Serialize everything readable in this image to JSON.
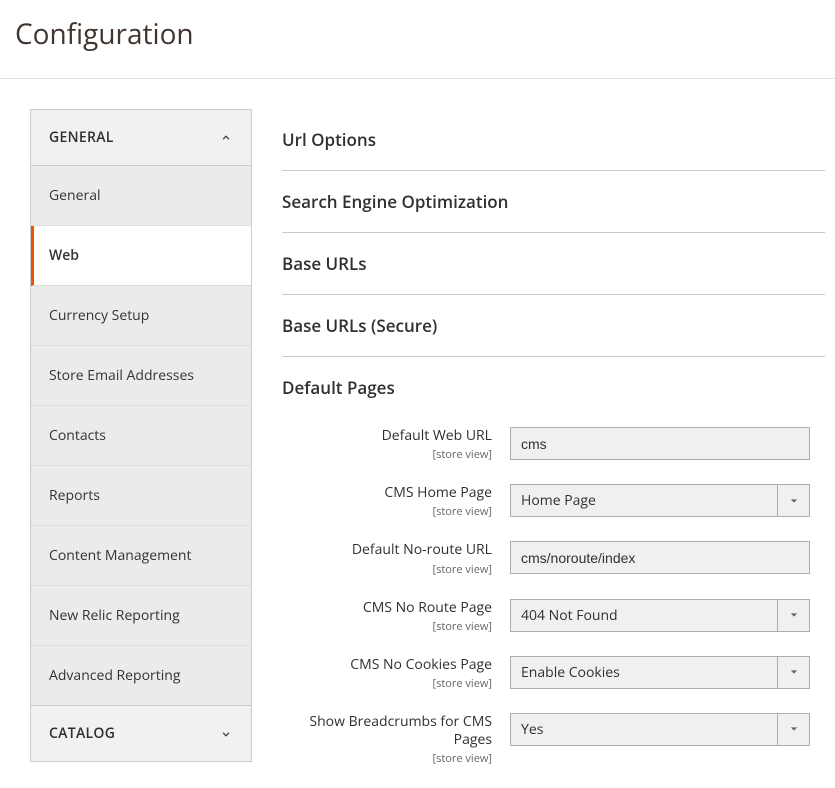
{
  "header": {
    "title": "Configuration"
  },
  "sidebar": {
    "groups": [
      {
        "label": "GENERAL",
        "expanded": true,
        "items": [
          {
            "label": "General"
          },
          {
            "label": "Web",
            "active": true
          },
          {
            "label": "Currency Setup"
          },
          {
            "label": "Store Email Addresses"
          },
          {
            "label": "Contacts"
          },
          {
            "label": "Reports"
          },
          {
            "label": "Content Management"
          },
          {
            "label": "New Relic Reporting"
          },
          {
            "label": "Advanced Reporting"
          }
        ]
      },
      {
        "label": "CATALOG",
        "expanded": false
      }
    ]
  },
  "sections": {
    "url_options": "Url Options",
    "seo": "Search Engine Optimization",
    "base_urls": "Base URLs",
    "base_urls_secure": "Base URLs (Secure)",
    "default_pages": "Default Pages"
  },
  "scope_label": "[store view]",
  "fields": {
    "default_web_url": {
      "label": "Default Web URL",
      "value": "cms"
    },
    "cms_home_page": {
      "label": "CMS Home Page",
      "value": "Home Page"
    },
    "default_noroute_url": {
      "label": "Default No-route URL",
      "value": "cms/noroute/index"
    },
    "cms_no_route_page": {
      "label": "CMS No Route Page",
      "value": "404 Not Found"
    },
    "cms_no_cookies_page": {
      "label": "CMS No Cookies Page",
      "value": "Enable Cookies"
    },
    "show_breadcrumbs": {
      "label": "Show Breadcrumbs for CMS Pages",
      "value": "Yes"
    }
  }
}
